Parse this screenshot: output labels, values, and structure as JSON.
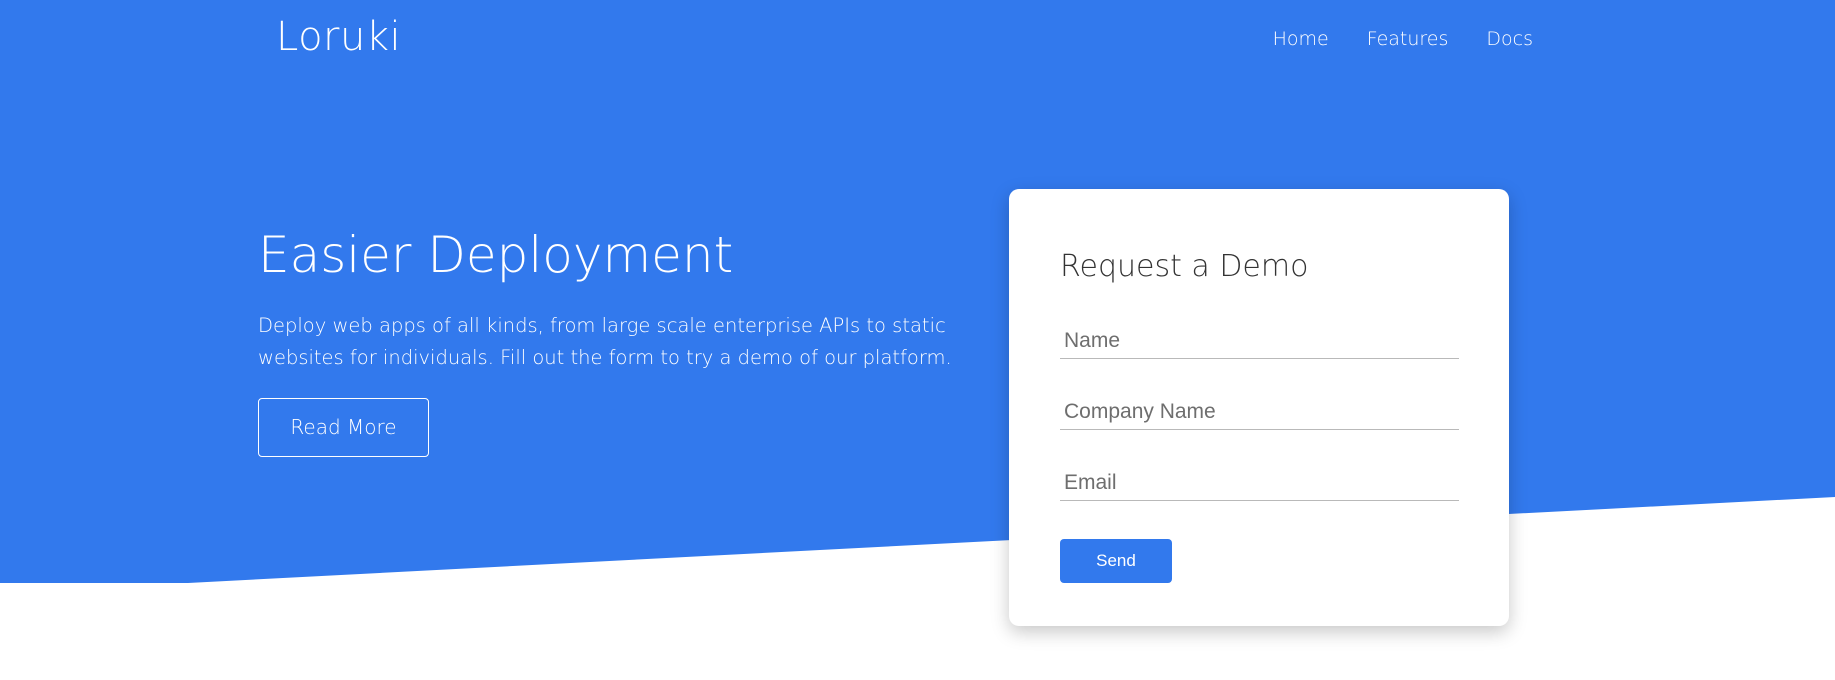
{
  "nav": {
    "brand": "Loruki",
    "links": [
      "Home",
      "Features",
      "Docs"
    ]
  },
  "hero": {
    "title": "Easier Deployment",
    "description": "Deploy web apps of all kinds, from large scale enterprise APIs to static websites for individuals. Fill out the form to try a demo of our platform.",
    "read_more": "Read More"
  },
  "form": {
    "title": "Request a Demo",
    "name_placeholder": "Name",
    "company_placeholder": "Company Name",
    "email_placeholder": "Email",
    "send_label": "Send"
  },
  "colors": {
    "primary": "#3279ed",
    "white": "#ffffff"
  }
}
